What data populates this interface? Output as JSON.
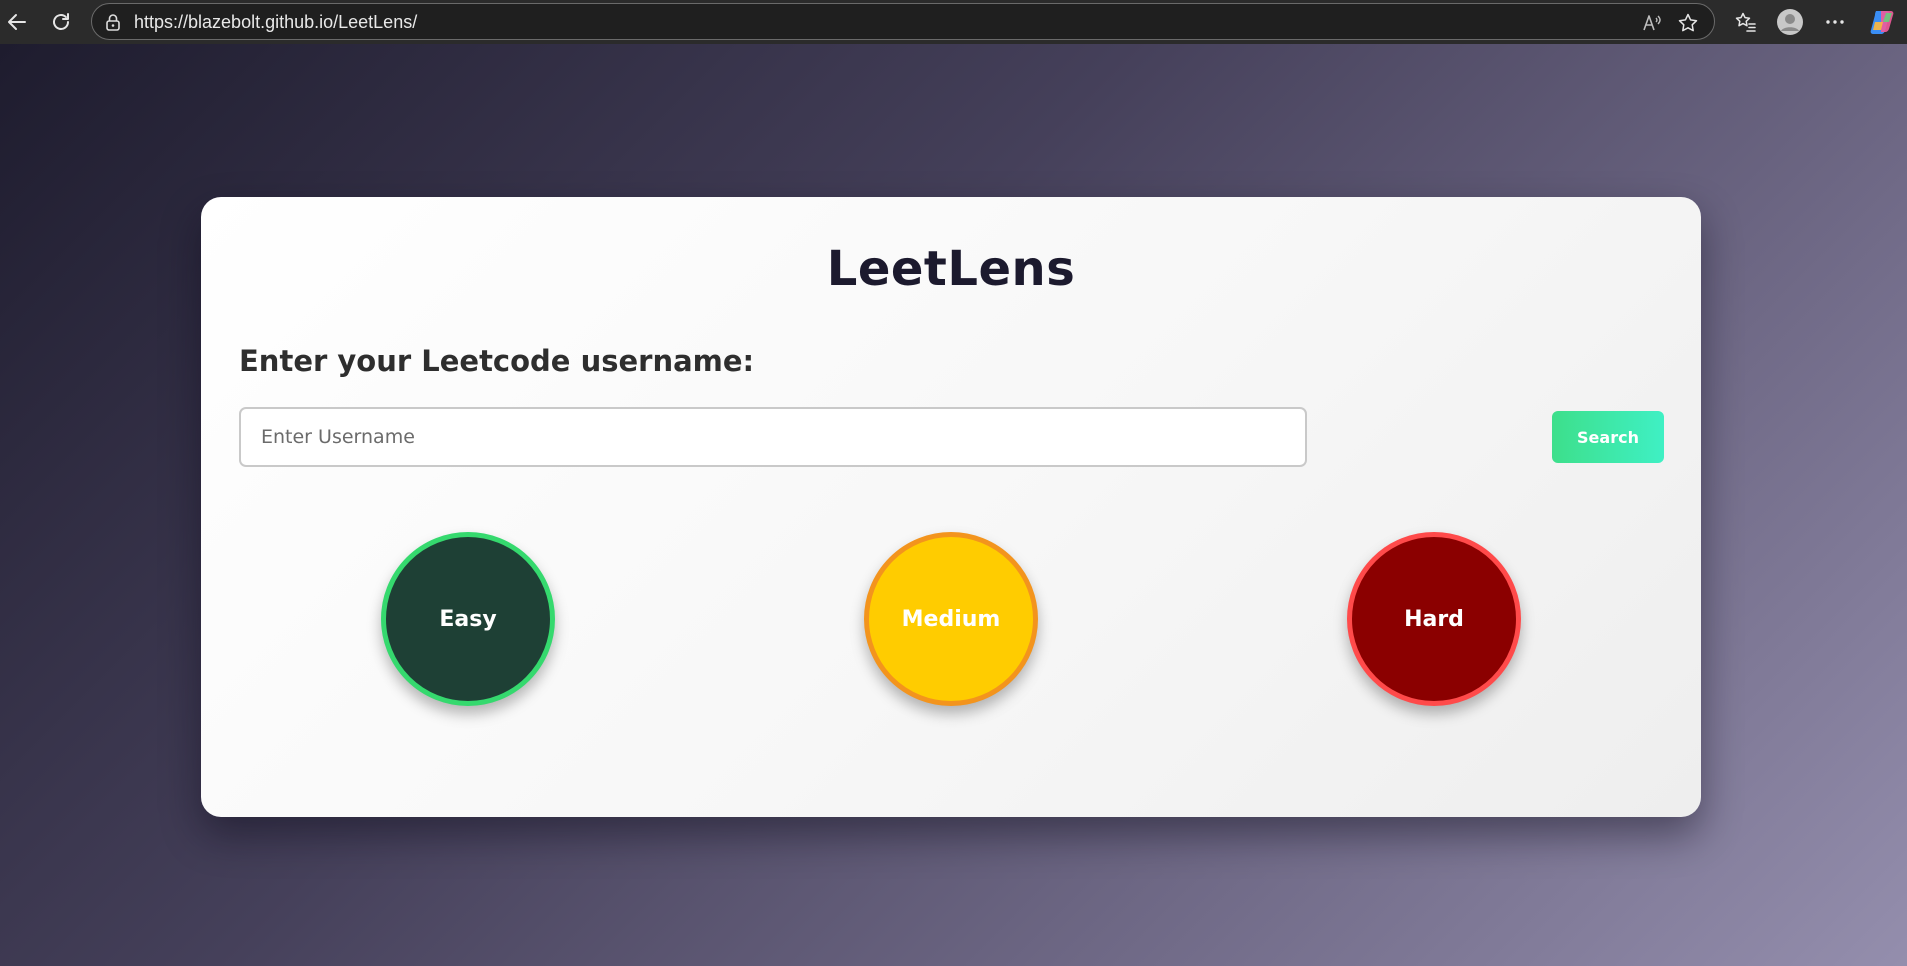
{
  "browser": {
    "url": "https://blazebolt.github.io/LeetLens/"
  },
  "app": {
    "title": "LeetLens",
    "prompt_label": "Enter your Leetcode username:",
    "username_placeholder": "Enter Username",
    "username_value": "",
    "search_label": "Search"
  },
  "difficulty": [
    {
      "label": "Easy",
      "fill": "#1e4035",
      "ring": "#35d96e"
    },
    {
      "label": "Medium",
      "fill": "#ffcc00",
      "ring": "#f3941d"
    },
    {
      "label": "Hard",
      "fill": "#8b0000",
      "ring": "#ff4a4a"
    }
  ],
  "colors": {
    "search_gradient_start": "#3ddf8b",
    "search_gradient_end": "#3ff0c4",
    "title_color": "#1c1a2e"
  },
  "icons": [
    "back-arrow-icon",
    "refresh-icon",
    "lock-icon",
    "read-aloud-icon",
    "star-icon",
    "favorites-icon",
    "profile-icon",
    "more-icon",
    "copilot-icon"
  ]
}
